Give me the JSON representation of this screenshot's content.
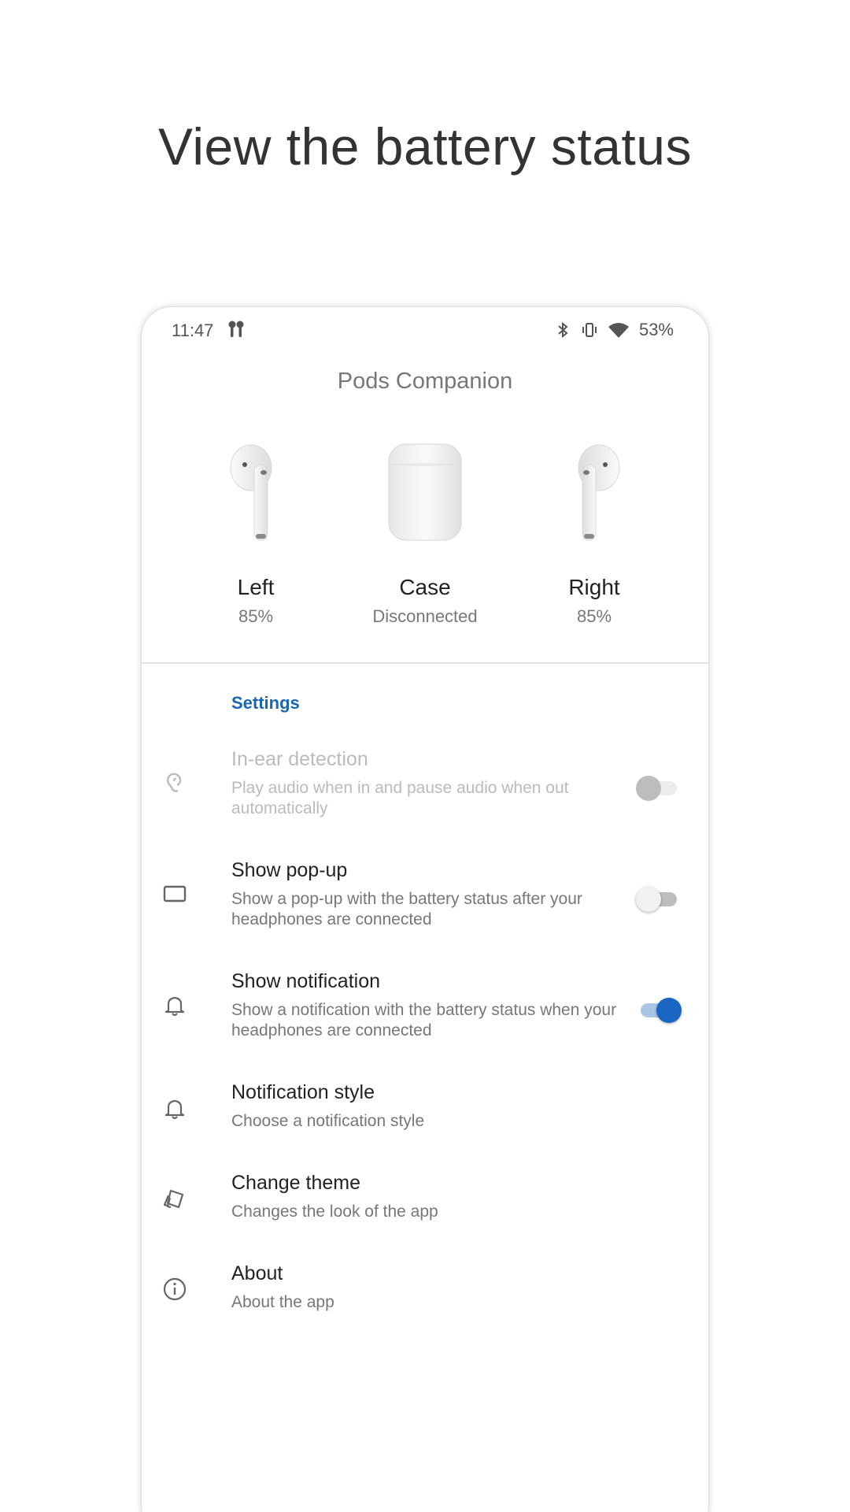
{
  "headline": "View the battery status",
  "status_bar": {
    "time": "11:47",
    "battery": "53%",
    "icons": [
      "airpods-icon",
      "bluetooth-icon",
      "vibrate-icon",
      "wifi-icon"
    ]
  },
  "app_title": "Pods Companion",
  "devices": {
    "left": {
      "name": "Left",
      "status": "85%"
    },
    "case": {
      "name": "Case",
      "status": "Disconnected"
    },
    "right": {
      "name": "Right",
      "status": "85%"
    }
  },
  "settings": {
    "header": "Settings",
    "items": [
      {
        "title": "In-ear detection",
        "summary": "Play audio when in and pause audio when out automatically",
        "icon": "ear-icon",
        "toggle": "off",
        "enabled": false
      },
      {
        "title": "Show pop-up",
        "summary": "Show a pop-up with the battery status after your headphones are connected",
        "icon": "popup-window-icon",
        "toggle": "off",
        "enabled": true
      },
      {
        "title": "Show notification",
        "summary": "Show a notification with the battery status when your headphones are connected",
        "icon": "bell-icon",
        "toggle": "on",
        "enabled": true
      },
      {
        "title": "Notification style",
        "summary": "Choose a notification style",
        "icon": "bell-icon",
        "enabled": true
      },
      {
        "title": "Change theme",
        "summary": "Changes the look of the app",
        "icon": "theme-icon",
        "enabled": true
      },
      {
        "title": "About",
        "summary": "About the app",
        "icon": "info-icon",
        "enabled": true
      }
    ]
  },
  "colors": {
    "accent": "#1a66c2",
    "section_header": "#1a66b2",
    "title_text": "#222222",
    "summary_text": "#777777"
  }
}
